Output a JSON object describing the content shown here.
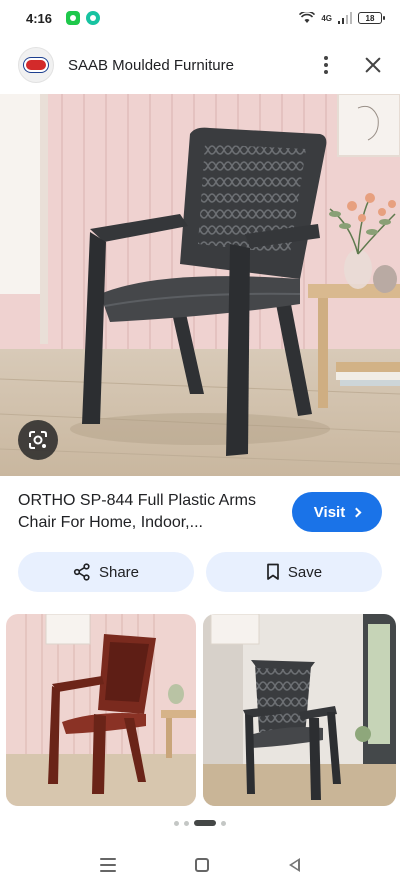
{
  "status_bar": {
    "time": "4:16",
    "network_label": "4G",
    "battery": "18"
  },
  "header": {
    "site_name": "SAAB Moulded Furniture",
    "more_icon": "more-vert-icon",
    "close_icon": "close-icon"
  },
  "hero": {
    "alt_subject": "dark grey plastic arm chair",
    "lens_icon": "lens-search-icon"
  },
  "product": {
    "title": "ORTHO SP-844 Full Plastic Arms Chair For Home, Indoor,..."
  },
  "actions": {
    "visit_label": "Visit",
    "share_label": "Share",
    "save_label": "Save"
  },
  "thumbnails": [
    {
      "subject": "maroon plastic arm chair",
      "chair_color": "#7a2a1e"
    },
    {
      "subject": "dark grey plastic arm chair",
      "chair_color": "#3b3d40"
    }
  ],
  "pager": {
    "count": 4,
    "active_index": 2
  },
  "colors": {
    "accent": "#1a73e8",
    "pill_bg": "#e8f0fe",
    "chair_dark": "#3a3c3f"
  }
}
